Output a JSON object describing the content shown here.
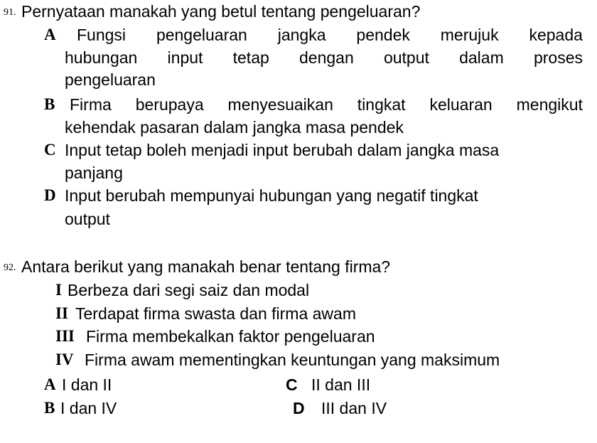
{
  "questions": [
    {
      "number": "91.",
      "text": "Pernyataan manakah yang betul tentang pengeluaran?",
      "options": [
        {
          "letter": "A",
          "lines": [
            "Fungsi pengeluaran jangka pendek merujuk kepada",
            "hubungan input tetap dengan output dalam proses",
            "pengeluaran"
          ]
        },
        {
          "letter": "B",
          "lines": [
            "Firma berupaya menyesuaikan tingkat keluaran mengikut",
            "kehendak pasaran dalam jangka masa pendek"
          ]
        },
        {
          "letter": "C",
          "lines": [
            "Input tetap boleh menjadi input berubah dalam jangka masa",
            "panjang"
          ]
        },
        {
          "letter": "D",
          "lines": [
            "Input berubah mempunyai hubungan yang negatif tingkat",
            "output"
          ]
        }
      ]
    },
    {
      "number": "92.",
      "text": "Antara berikut yang manakah benar tentang firma?",
      "statements": [
        {
          "roman": "I",
          "text": "Berbeza dari segi saiz dan modal"
        },
        {
          "roman": "II",
          "text": "Terdapat firma swasta dan firma awam"
        },
        {
          "roman": "III",
          "text": "Firma membekalkan faktor pengeluaran"
        },
        {
          "roman": "IV",
          "text": "Firma awam mementingkan keuntungan yang maksimum"
        }
      ],
      "options": [
        {
          "letter": "A",
          "text": "I dan II"
        },
        {
          "letter": "B",
          "text": "I dan IV"
        },
        {
          "letter": "C",
          "text": "II dan III"
        },
        {
          "letter": "D",
          "text": "III dan IV"
        }
      ]
    }
  ]
}
